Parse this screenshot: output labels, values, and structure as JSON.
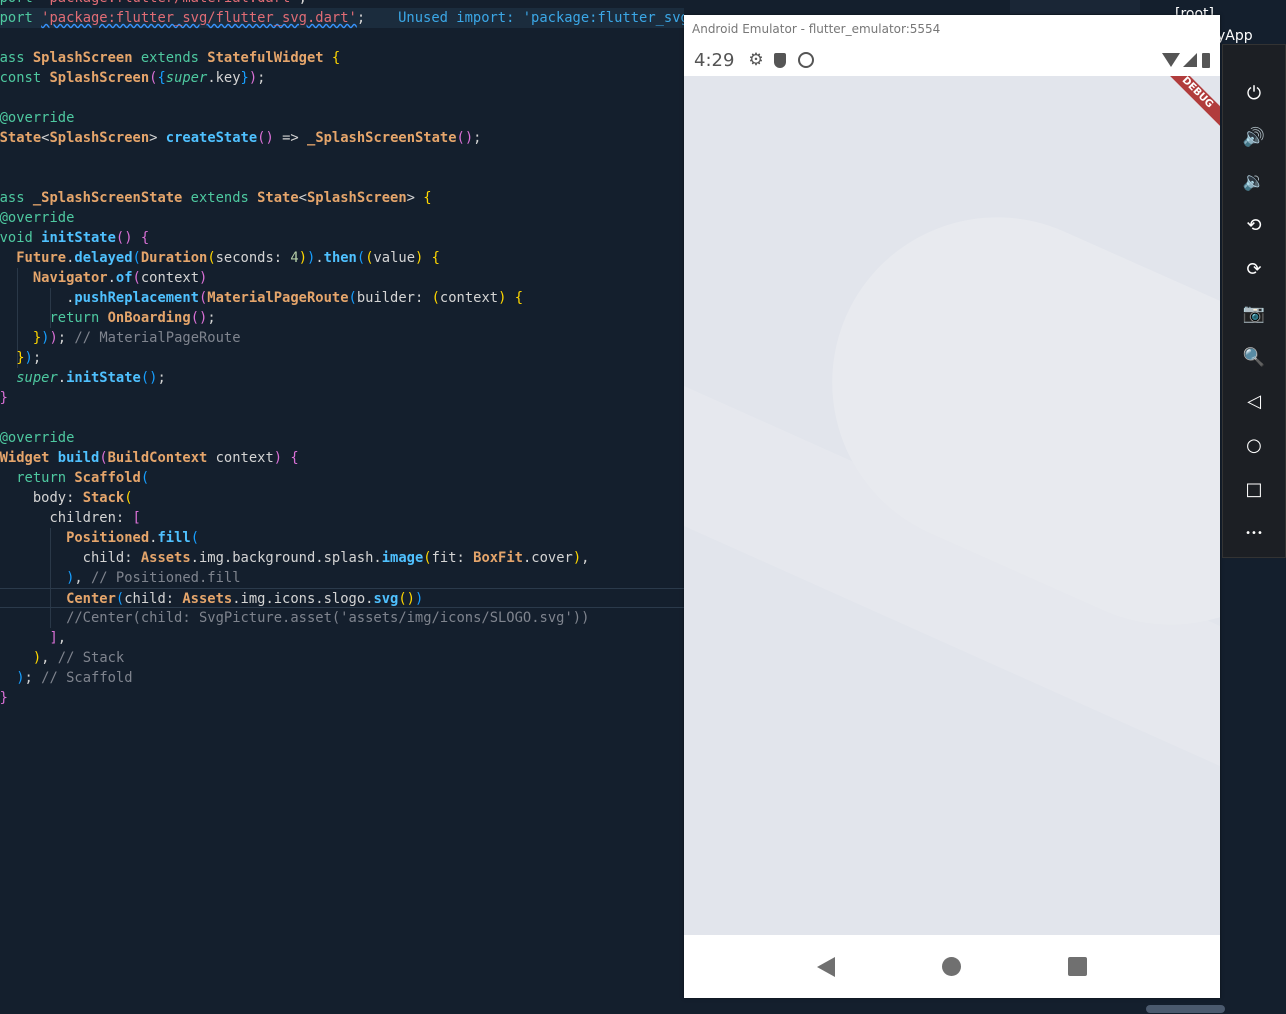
{
  "editor": {
    "unused_hint": "Unused import: 'package:flutter_svg/flutter_svg.dart'",
    "lines": [
      [
        [
          "k",
          "import "
        ],
        [
          "s",
          "'package:flutter/material.dart'"
        ],
        [
          "p",
          ";"
        ]
      ],
      [
        [
          "k",
          "import "
        ],
        [
          "sq",
          "'package:flutter_svg/flutter_svg.dart'"
        ],
        [
          "p",
          ";"
        ]
      ],
      [],
      [
        [
          "k",
          "class "
        ],
        [
          "t",
          "SplashScreen "
        ],
        [
          "k",
          "extends "
        ],
        [
          "t",
          "StatefulWidget "
        ],
        [
          "y",
          "{"
        ]
      ],
      [
        [
          "k",
          "  const "
        ],
        [
          "t",
          "SplashScreen"
        ],
        [
          "m",
          "("
        ],
        [
          "b",
          "{"
        ],
        [
          "i",
          "super"
        ],
        [
          "p",
          ".key"
        ],
        [
          "b",
          "}"
        ],
        [
          "m",
          ")"
        ],
        [
          "p",
          ";"
        ]
      ],
      [],
      [
        [
          "a",
          "  @override"
        ]
      ],
      [
        [
          "t",
          "  State"
        ],
        [
          "p",
          "<"
        ],
        [
          "t",
          "SplashScreen"
        ],
        [
          "p",
          "> "
        ],
        [
          "f",
          "createState"
        ],
        [
          "m",
          "()"
        ],
        [
          "p",
          " => "
        ],
        [
          "t",
          "_SplashScreenState"
        ],
        [
          "m",
          "()"
        ],
        [
          "p",
          ";"
        ]
      ],
      [
        [
          "y",
          "}"
        ]
      ],
      [],
      [
        [
          "k",
          "class "
        ],
        [
          "t",
          "_SplashScreenState "
        ],
        [
          "k",
          "extends "
        ],
        [
          "t",
          "State"
        ],
        [
          "p",
          "<"
        ],
        [
          "t",
          "SplashScreen"
        ],
        [
          "p",
          "> "
        ],
        [
          "y",
          "{"
        ]
      ],
      [
        [
          "a",
          "  @override"
        ]
      ],
      [
        [
          "k",
          "  void "
        ],
        [
          "f",
          "initState"
        ],
        [
          "m",
          "()"
        ],
        [
          "p",
          " "
        ],
        [
          "m",
          "{"
        ]
      ],
      [
        [
          "t",
          "    Future"
        ],
        [
          "p",
          "."
        ],
        [
          "f",
          "delayed"
        ],
        [
          "b",
          "("
        ],
        [
          "t",
          "Duration"
        ],
        [
          "y",
          "("
        ],
        [
          "p",
          "seconds: "
        ],
        [
          "n",
          "4"
        ],
        [
          "y",
          ")"
        ],
        [
          "b",
          ")"
        ],
        [
          "p",
          "."
        ],
        [
          "f",
          "then"
        ],
        [
          "b",
          "("
        ],
        [
          "y",
          "("
        ],
        [
          "p",
          "value"
        ],
        [
          "y",
          ")"
        ],
        [
          "p",
          " "
        ],
        [
          "y",
          "{"
        ]
      ],
      [
        [
          "t",
          "      Navigator"
        ],
        [
          "p",
          "."
        ],
        [
          "f",
          "of"
        ],
        [
          "m",
          "("
        ],
        [
          "p",
          "context"
        ],
        [
          "m",
          ")"
        ]
      ],
      [
        [
          "p",
          "          ."
        ],
        [
          "f",
          "pushReplacement"
        ],
        [
          "m",
          "("
        ],
        [
          "t",
          "MaterialPageRoute"
        ],
        [
          "b",
          "("
        ],
        [
          "p",
          "builder: "
        ],
        [
          "y",
          "("
        ],
        [
          "p",
          "context"
        ],
        [
          "y",
          ")"
        ],
        [
          "p",
          " "
        ],
        [
          "y",
          "{"
        ]
      ],
      [
        [
          "k",
          "        return "
        ],
        [
          "t",
          "OnBoarding"
        ],
        [
          "m",
          "()"
        ],
        [
          "p",
          ";"
        ]
      ],
      [
        [
          "y",
          "      }"
        ],
        [
          "b",
          ")"
        ],
        [
          "m",
          ")"
        ],
        [
          "p",
          "; "
        ],
        [
          "c",
          "// MaterialPageRoute"
        ]
      ],
      [
        [
          "y",
          "    }"
        ],
        [
          "b",
          ")"
        ],
        [
          "p",
          ";"
        ]
      ],
      [
        [
          "i",
          "    super"
        ],
        [
          "p",
          "."
        ],
        [
          "f",
          "initState"
        ],
        [
          "b",
          "()"
        ],
        [
          "p",
          ";"
        ]
      ],
      [
        [
          "m",
          "  }"
        ]
      ],
      [],
      [
        [
          "a",
          "  @override"
        ]
      ],
      [
        [
          "t",
          "  Widget "
        ],
        [
          "f",
          "build"
        ],
        [
          "m",
          "("
        ],
        [
          "t",
          "BuildContext "
        ],
        [
          "p",
          "context"
        ],
        [
          "m",
          ")"
        ],
        [
          "p",
          " "
        ],
        [
          "m",
          "{"
        ]
      ],
      [
        [
          "k",
          "    return "
        ],
        [
          "t",
          "Scaffold"
        ],
        [
          "b",
          "("
        ]
      ],
      [
        [
          "p",
          "      body: "
        ],
        [
          "t",
          "Stack"
        ],
        [
          "y",
          "("
        ]
      ],
      [
        [
          "p",
          "        children: "
        ],
        [
          "m",
          "["
        ]
      ],
      [
        [
          "t",
          "          Positioned"
        ],
        [
          "p",
          "."
        ],
        [
          "f",
          "fill"
        ],
        [
          "b",
          "("
        ]
      ],
      [
        [
          "p",
          "            child: "
        ],
        [
          "t",
          "Assets"
        ],
        [
          "p",
          ".img.background.splash."
        ],
        [
          "f",
          "image"
        ],
        [
          "y",
          "("
        ],
        [
          "p",
          "fit: "
        ],
        [
          "t",
          "BoxFit"
        ],
        [
          "p",
          ".cover"
        ],
        [
          "y",
          ")"
        ],
        [
          "p",
          ","
        ]
      ],
      [
        [
          "b",
          "          )"
        ],
        [
          "p",
          ", "
        ],
        [
          "c",
          "// Positioned.fill"
        ]
      ],
      [
        [
          "t",
          "          Center"
        ],
        [
          "b",
          "("
        ],
        [
          "p",
          "child: "
        ],
        [
          "t",
          "Assets"
        ],
        [
          "p",
          ".img.icons.slogo."
        ],
        [
          "f",
          "svg"
        ],
        [
          "y",
          "()"
        ],
        [
          "b",
          ")"
        ]
      ],
      [
        [
          "c",
          "          //Center(child: SvgPicture.asset('assets/img/icons/SLOGO.svg'))"
        ]
      ],
      [
        [
          "m",
          "        ]"
        ],
        [
          "p",
          ","
        ]
      ],
      [
        [
          "y",
          "      )"
        ],
        [
          "p",
          ", "
        ],
        [
          "c",
          "// Stack"
        ]
      ],
      [
        [
          "b",
          "    )"
        ],
        [
          "p",
          "; "
        ],
        [
          "c",
          "// Scaffold"
        ]
      ],
      [
        [
          "m",
          "  }"
        ]
      ]
    ]
  },
  "explorer": {
    "root": "[root]",
    "app": "yApp"
  },
  "emulator": {
    "title": "Android Emulator - flutter_emulator:5554",
    "time": "4:29",
    "debug_banner": "DEBUG",
    "screen_color": "#e2e5ec",
    "toolbar": [
      {
        "icon": "power-icon",
        "glyph": "⏻"
      },
      {
        "icon": "volume-up-icon",
        "glyph": "🔊"
      },
      {
        "icon": "volume-down-icon",
        "glyph": "🔉"
      },
      {
        "icon": "rotate-left-icon",
        "glyph": "⟲"
      },
      {
        "icon": "rotate-right-icon",
        "glyph": "⟳"
      },
      {
        "icon": "camera-icon",
        "glyph": "📷"
      },
      {
        "icon": "zoom-icon",
        "glyph": "🔍"
      },
      {
        "icon": "back-icon",
        "glyph": "◁"
      },
      {
        "icon": "home-icon",
        "glyph": "○"
      },
      {
        "icon": "overview-icon",
        "glyph": "□"
      },
      {
        "icon": "more-icon",
        "glyph": "•••"
      }
    ],
    "minimize": "−",
    "close": "×"
  }
}
